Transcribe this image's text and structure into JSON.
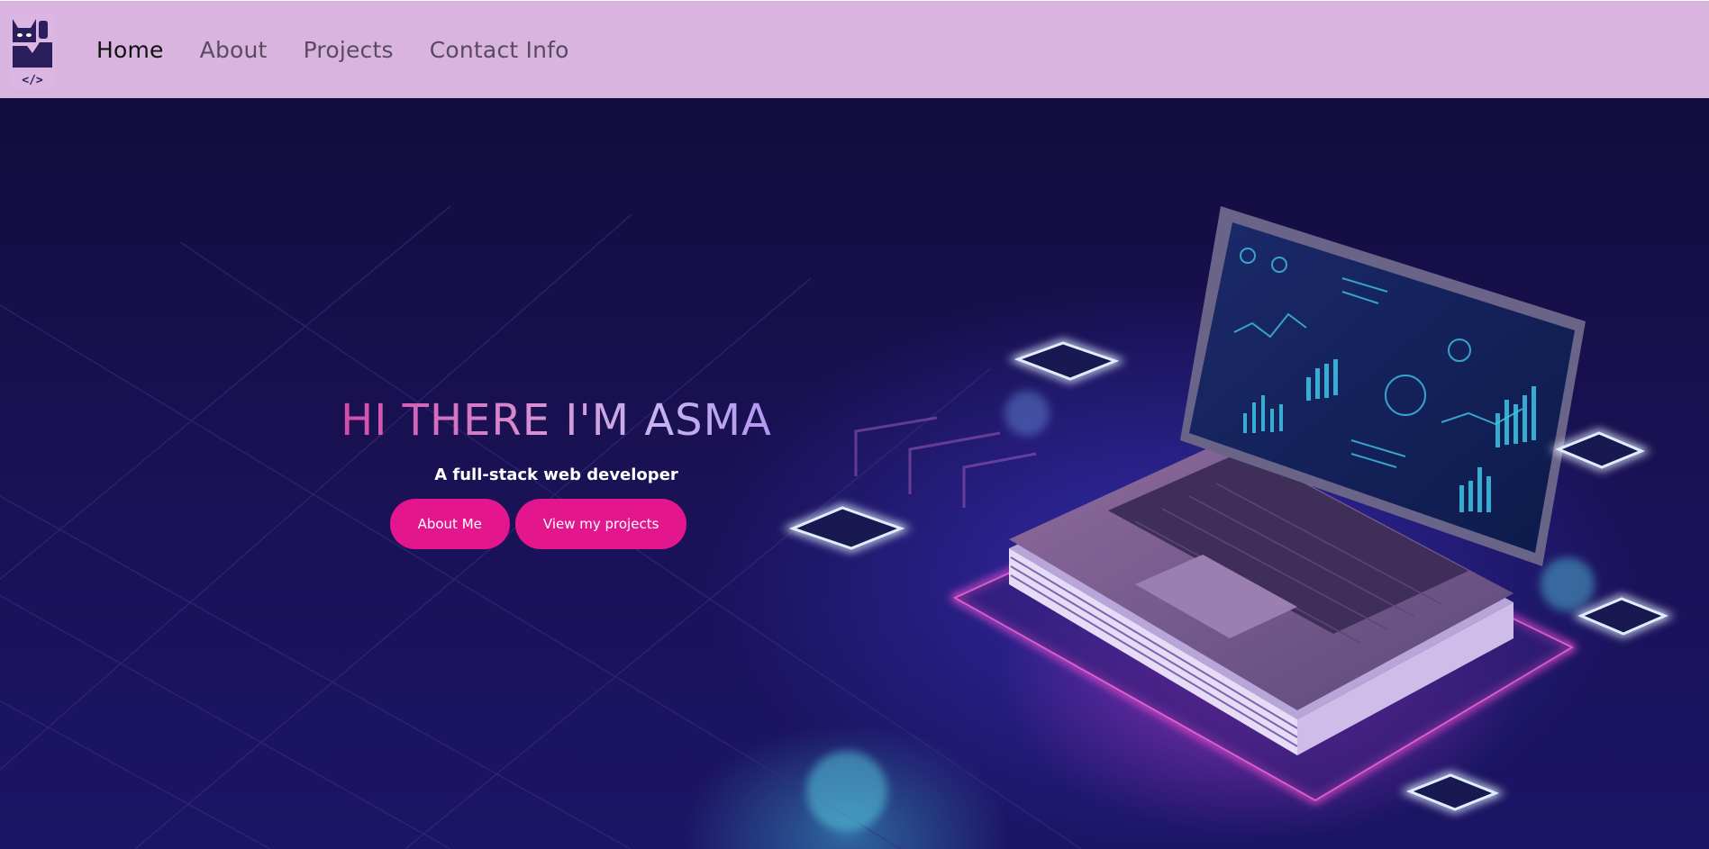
{
  "nav": {
    "logo_text": "</>",
    "links": [
      {
        "label": "Home",
        "active": true
      },
      {
        "label": "About",
        "active": false
      },
      {
        "label": "Projects",
        "active": false
      },
      {
        "label": "Contact Info",
        "active": false
      }
    ]
  },
  "hero": {
    "title": "HI THERE I'M ASMA",
    "subtitle": "A full-stack web developer",
    "buttons": {
      "about_label": "About Me",
      "projects_label": "View my projects"
    },
    "image_subject": "laptop-illustration"
  },
  "colors": {
    "navbar_bg": "#d8b4de",
    "accent_pink": "#e4168e",
    "hero_dark": "#120c3e"
  }
}
